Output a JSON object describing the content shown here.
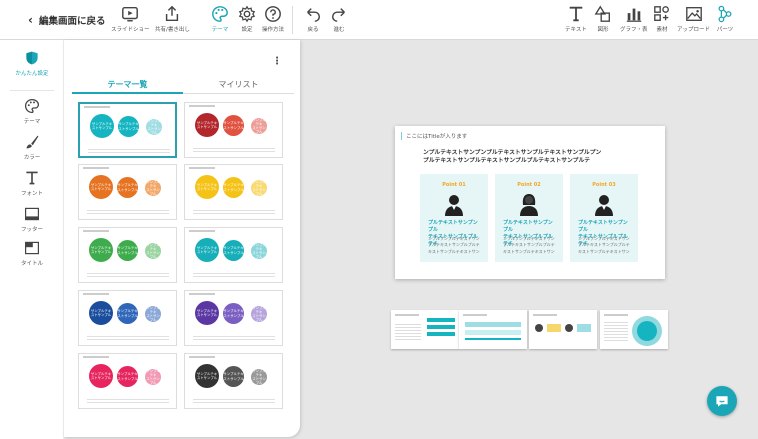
{
  "toolbar": {
    "back_label": "編集画面に戻る",
    "items": [
      {
        "label": "スライドショー"
      },
      {
        "label": "共有/書き出し"
      },
      {
        "label": "テーマ"
      },
      {
        "label": "設定"
      },
      {
        "label": "操作方法"
      },
      {
        "label": "戻る"
      },
      {
        "label": "進む"
      },
      {
        "label": "テキスト"
      },
      {
        "label": "図形"
      },
      {
        "label": "グラフ・表"
      },
      {
        "label": "素材"
      },
      {
        "label": "アップロード"
      },
      {
        "label": "パーツ"
      }
    ]
  },
  "leftnav": {
    "items": [
      {
        "label": "かんたん設定"
      },
      {
        "label": "テーマ"
      },
      {
        "label": "カラー"
      },
      {
        "label": "フォント"
      },
      {
        "label": "フッター"
      },
      {
        "label": "タイトル"
      }
    ]
  },
  "panel": {
    "more": "⋮",
    "tabs": [
      {
        "label": "テーマ一覧"
      },
      {
        "label": "マイリスト"
      }
    ],
    "themes": [
      {
        "colors": [
          "#14b4c1",
          "#14b4c1",
          "#9fdde3"
        ],
        "label": "サンプルテキ\nストサンプル"
      },
      {
        "colors": [
          "#b3262b",
          "#e0523f",
          "#ee9e98"
        ],
        "label": "サンプルテキ\nストサンプル"
      },
      {
        "colors": [
          "#e67321",
          "#e67321",
          "#f3a86a"
        ],
        "label": "サンプルテキ\nストサンプル"
      },
      {
        "colors": [
          "#f5c216",
          "#f5c216",
          "#f8da73"
        ],
        "label": "サンプルテキ\nストサンプル"
      },
      {
        "colors": [
          "#3eac4d",
          "#3eac4d",
          "#9ad4a0"
        ],
        "label": "サンプルテキ\nストサンプル"
      },
      {
        "colors": [
          "#16aeb8",
          "#16aeb8",
          "#8bd6db"
        ],
        "label": "サンプルテキ\nストサンプル"
      },
      {
        "colors": [
          "#1a4d9c",
          "#2f66b9",
          "#8aa7d8"
        ],
        "label": "サンプルテキ\nストサンプル"
      },
      {
        "colors": [
          "#5b37a3",
          "#7b5ec2",
          "#b6a4dc"
        ],
        "label": "サンプルテキ\nストサンプル"
      },
      {
        "colors": [
          "#e6245d",
          "#e6245d",
          "#f29ab3"
        ],
        "label": "サンプルテキ\nストサンプル"
      },
      {
        "colors": [
          "#333333",
          "#555555",
          "#999999"
        ],
        "label": "サンプルテキ\nストサンプル"
      }
    ]
  },
  "slide": {
    "title": "ここにはTitleが入ります",
    "body": "ンプルテキストサンプンプルテキストサンプルテキストサンプルプン\nプルテキストサンプルテキストサンプルプルテキストサンプルテ",
    "cards": [
      {
        "point": "Point 01",
        "head": "プルテキストサンプンプル\nテキストサンプルプルテキ",
        "text": "ンプルプンプルテキストサン\nプルテキストサンプルプルテ\nキストサンプルテキストサン"
      },
      {
        "point": "Point 02",
        "head": "プルテキストサンプンプル\nテキストサンプルプルテキ",
        "text": "ンプルプンプルテキストサン\nプルテキストサンプルプルテ\nキストサンプルテキストサン"
      },
      {
        "point": "Point 03",
        "head": "プルテキストサンプンプル\nテキストサンプルプルテキ",
        "text": "ンプルプンプルテキストサン\nプルテキストサンプルプルテ\nキストサンプルテキストサン"
      }
    ]
  },
  "colors": {
    "accent": "#1aa6b7",
    "point": "#f5a623"
  }
}
